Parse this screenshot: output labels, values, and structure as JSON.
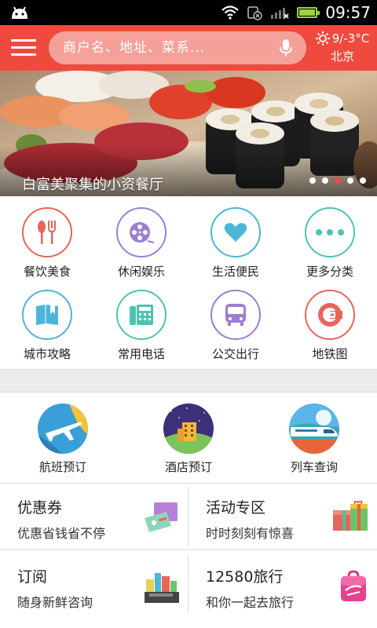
{
  "status_bar": {
    "time": "09:57"
  },
  "header": {
    "search_placeholder": "商户名、地址、菜系...",
    "weather": {
      "temperature": "9/-3°C",
      "city": "北京"
    }
  },
  "banner": {
    "caption": "白富美聚集的小资餐厅",
    "slide_count": 5,
    "active_slide": 3
  },
  "categories": [
    {
      "label": "餐饮美食",
      "icon": "fork-knife-icon",
      "color": "#e8655a"
    },
    {
      "label": "休闲娱乐",
      "icon": "film-reel-icon",
      "color": "#9a7fd1"
    },
    {
      "label": "生活便民",
      "icon": "heart-icon",
      "color": "#4bb6d8"
    },
    {
      "label": "更多分类",
      "icon": "more-dots-icon",
      "color": "#4cc4b0"
    },
    {
      "label": "城市攻略",
      "icon": "city-guide-icon",
      "color": "#4bb6d8"
    },
    {
      "label": "常用电话",
      "icon": "telephone-icon",
      "color": "#4cc4b0"
    },
    {
      "label": "公交出行",
      "icon": "bus-icon",
      "color": "#9a7fd1"
    },
    {
      "label": "地铁图",
      "icon": "subway-logo-icon",
      "color": "#e8655a"
    }
  ],
  "booking": [
    {
      "label": "航班预订",
      "icon": "airplane-icon"
    },
    {
      "label": "酒店预订",
      "icon": "hotel-icon"
    },
    {
      "label": "列车查询",
      "icon": "train-icon"
    }
  ],
  "cards": [
    {
      "title": "优惠券",
      "subtitle": "优惠省钱省不停",
      "icon": "coupon-icon"
    },
    {
      "title": "活动专区",
      "subtitle": "时时刻刻有惊喜",
      "icon": "gift-icon"
    },
    {
      "title": "订阅",
      "subtitle": "随身新鲜咨询",
      "icon": "books-icon"
    },
    {
      "title": "12580旅行",
      "subtitle": "和你一起去旅行",
      "icon": "travel-bag-icon"
    }
  ]
}
